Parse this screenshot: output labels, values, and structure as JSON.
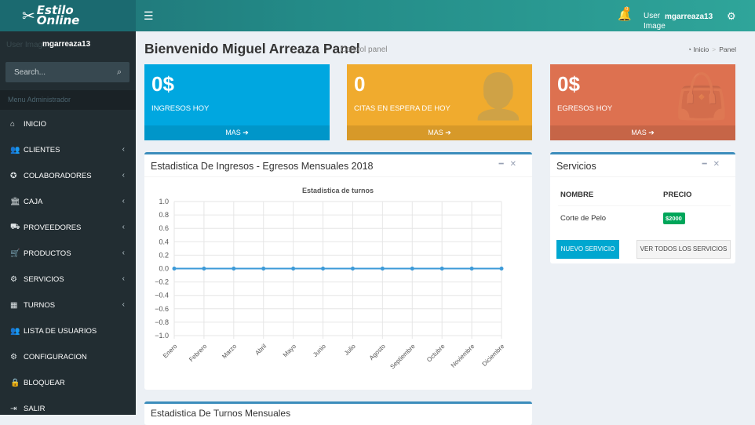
{
  "header": {
    "logo_text_1": "Estilo",
    "logo_text_2": "Online",
    "notif_count": "0",
    "user_image_label": "User Image",
    "username": "mgarreaza13"
  },
  "sidebar": {
    "status": "User Image",
    "username": "mgarreaza13",
    "search_placeholder": "Search...",
    "menu_header": "Menu Administrador",
    "items": [
      {
        "label": "INICIO",
        "icon": "home-icon",
        "glyph": "⌂",
        "chevron": false
      },
      {
        "label": "CLIENTES",
        "icon": "users-icon",
        "glyph": "👥",
        "chevron": true
      },
      {
        "label": "COLABORADORES",
        "icon": "ribbon-icon",
        "glyph": "✪",
        "chevron": true
      },
      {
        "label": "CAJA",
        "icon": "bank-icon",
        "glyph": "🏛",
        "chevron": true
      },
      {
        "label": "PROVEEDORES",
        "icon": "truck-icon",
        "glyph": "⛟",
        "chevron": true
      },
      {
        "label": "PRODUCTOS",
        "icon": "cart-icon",
        "glyph": "🛒",
        "chevron": true
      },
      {
        "label": "SERVICIOS",
        "icon": "cog-icon",
        "glyph": "⚙",
        "chevron": true
      },
      {
        "label": "TURNOS",
        "icon": "calendar-icon",
        "glyph": "▦",
        "chevron": true
      },
      {
        "label": "LISTA DE USUARIOS",
        "icon": "users-icon",
        "glyph": "👥",
        "chevron": false
      },
      {
        "label": "CONFIGURACION",
        "icon": "cogs-icon",
        "glyph": "⚙",
        "chevron": false
      },
      {
        "label": "BLOQUEAR",
        "icon": "lock-icon",
        "glyph": "🔒",
        "chevron": false
      },
      {
        "label": "SALIR",
        "icon": "sign-out-icon",
        "glyph": "⇥",
        "chevron": false
      }
    ]
  },
  "page": {
    "title": "Bienvenido Miguel Arreaza Panel",
    "subtitle": "Control panel",
    "breadcrumb_home": "Inicio",
    "breadcrumb_current": "Panel"
  },
  "stats": [
    {
      "value": "0$",
      "label": "INGRESOS HOY",
      "footer": "MAS",
      "color": "#00a7e0"
    },
    {
      "value": "0",
      "label": "CITAS EN ESPERA DE HOY",
      "footer": "MAS",
      "color": "#f0ab2e"
    },
    {
      "value": "0$",
      "label": "EGRESOS HOY",
      "footer": "MAS",
      "color": "#dd7150"
    }
  ],
  "chart_box": {
    "title": "Estadistica De Ingresos - Egresos Mensuales 2018"
  },
  "chart_data": {
    "type": "line",
    "title": "Estadistica de turnos",
    "categories": [
      "Enero",
      "Febrero",
      "Marzo",
      "Abril",
      "Mayo",
      "Junio",
      "Julio",
      "Agosto",
      "Septiembre",
      "Octubre",
      "Noviembre",
      "Diciembre"
    ],
    "values": [
      0,
      0,
      0,
      0,
      0,
      0,
      0,
      0,
      0,
      0,
      0,
      0
    ],
    "ylim": [
      -1.0,
      1.0
    ],
    "yticks": [
      "1.0",
      "0.8",
      "0.6",
      "0.4",
      "0.2",
      "0.0",
      "−0.2",
      "−0.4",
      "−0.6",
      "−0.8",
      "−1.0"
    ],
    "grid": true,
    "color": "#3c9ad8"
  },
  "services_box": {
    "title": "Servicios",
    "col_name": "NOMBRE",
    "col_price": "PRECIO",
    "rows": [
      {
        "name": "Corte de Pelo",
        "price": "$2000"
      }
    ],
    "btn_new": "NUEVO SERVICIO",
    "btn_all": "VER TODOS LOS SERVICIOS"
  },
  "bottom_box": {
    "title": "Estadistica De Turnos Mensuales"
  }
}
